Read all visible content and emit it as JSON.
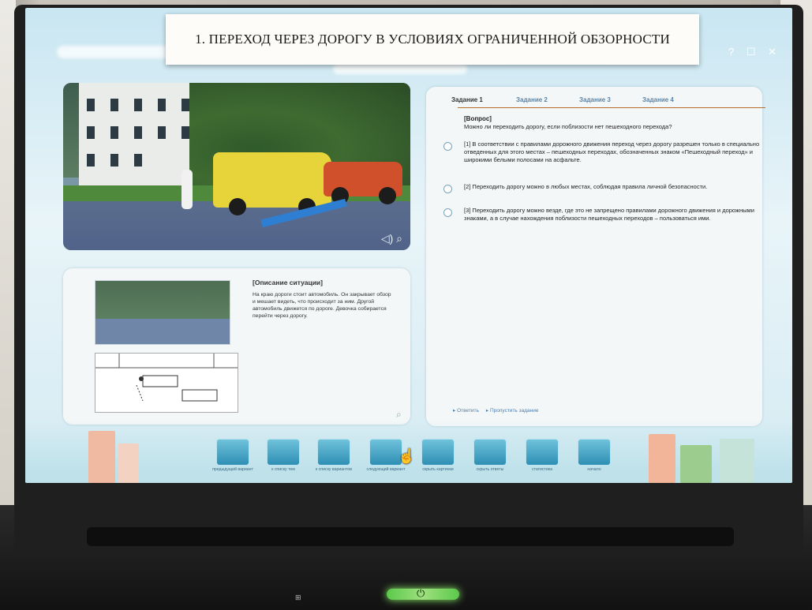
{
  "title": "1. ПЕРЕХОД ЧЕРЕЗ ДОРОГУ В УСЛОВИЯХ ОГРАНИЧЕННОЙ ОБЗОРНОСТИ",
  "window_controls": "? ☐ ✕",
  "tabs": [
    "Задание 1",
    "Задание 2",
    "Задание 3",
    "Задание 4"
  ],
  "question": {
    "label": "[Вопрос]",
    "text": "Можно ли переходить дорогу, если поблизости нет пешеходного перехода?"
  },
  "options": [
    "[1] В соответствии с правилами дорожного движения переход через дорогу разрешен только в специально отведенных для этого местах – пешеходных переходах, обозначенных знаком «Пешеходный переход» и широкими белыми полосами на асфальте.",
    "[2] Переходить дорогу можно в любых местах, соблюдая правила личной безопасности.",
    "[3] Переходить дорогу можно везде, где это не запрещено правилами дорожного движения и дорожными знаками, а в случае нахождения поблизости пешеходных переходов – пользоваться ими."
  ],
  "situation": {
    "label": "[Описание ситуации]",
    "text": "На краю дороги стоит автомобиль. Он закрывает обзор и мешает видеть, что происходит за ним. Другой автомобиль движется по дороге. Девочка собирается перейти через дорогу."
  },
  "actions": [
    "Ответить",
    "Пропустить задание"
  ],
  "nav_labels": [
    "предыдущий вариант",
    "к списку тем",
    "к списку вариантов",
    "следующий вариант",
    "скрыть картинки",
    "скрыть ответы",
    "статистика",
    "начало"
  ],
  "colors": {
    "accent": "#2e8fb4",
    "tab_line": "#b66f2b",
    "power_led": "#5bc94b"
  }
}
